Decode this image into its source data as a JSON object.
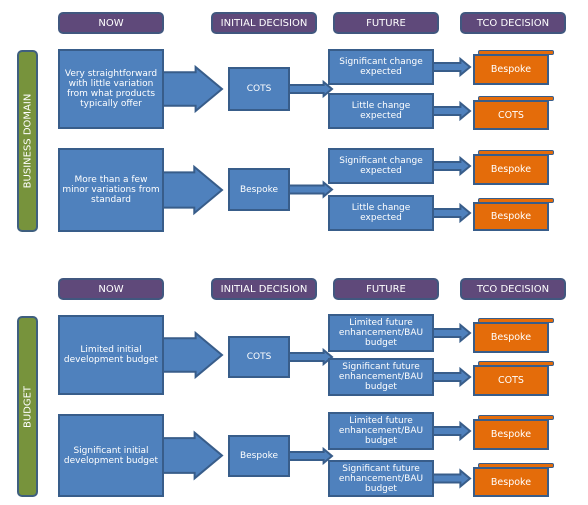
{
  "headers": {
    "now": "NOW",
    "initial": "INITIAL DECISION",
    "future": "FUTURE",
    "tco": "TCO DECISION"
  },
  "sections": [
    {
      "label": "BUSINESS DOMAIN",
      "now": [
        "Very straightforward with little variation from what products typically offer",
        "More than a few minor variations from standard"
      ],
      "initial": [
        "COTS",
        "Bespoke"
      ],
      "future": [
        "Significant change expected",
        "Little change expected",
        "Significant change expected",
        "Little change expected"
      ],
      "tco": [
        "Bespoke",
        "COTS",
        "Bespoke",
        "Bespoke"
      ]
    },
    {
      "label": "BUDGET",
      "now": [
        "Limited initial development budget",
        "Significant initial development budget"
      ],
      "initial": [
        "COTS",
        "Bespoke"
      ],
      "future": [
        "Limited future enhancement/BAU budget",
        "Significant future enhancement/BAU budget",
        "Limited future enhancement/BAU budget",
        "Significant future enhancement/BAU budget"
      ],
      "tco": [
        "Bespoke",
        "COTS",
        "Bespoke",
        "Bespoke"
      ]
    }
  ],
  "colors": {
    "header": "#5f497a",
    "side": "#77933c",
    "box": "#4f81bd",
    "tco": "#e46c0a"
  }
}
